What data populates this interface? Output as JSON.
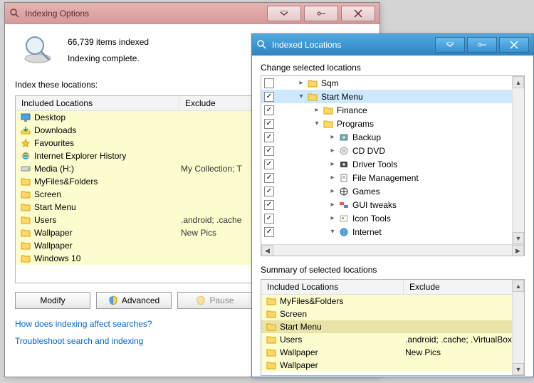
{
  "options_window": {
    "title": "Indexing Options",
    "items_indexed": "66,739 items indexed",
    "status": "Indexing complete.",
    "section_label": "Index these locations:",
    "columns": {
      "included": "Included Locations",
      "exclude": "Exclude"
    },
    "rows": [
      {
        "icon": "desktop",
        "name": "Desktop",
        "exclude": ""
      },
      {
        "icon": "downloads",
        "name": "Downloads",
        "exclude": ""
      },
      {
        "icon": "star",
        "name": "Favourites",
        "exclude": ""
      },
      {
        "icon": "ie",
        "name": "Internet Explorer History",
        "exclude": ""
      },
      {
        "icon": "drive",
        "name": "Media (H:)",
        "exclude": "My Collection; T"
      },
      {
        "icon": "folder",
        "name": "MyFiles&Folders",
        "exclude": ""
      },
      {
        "icon": "folder",
        "name": "Screen",
        "exclude": ""
      },
      {
        "icon": "folder",
        "name": "Start Menu",
        "exclude": ""
      },
      {
        "icon": "folder",
        "name": "Users",
        "exclude": ".android; .cache"
      },
      {
        "icon": "folder",
        "name": "Wallpaper",
        "exclude": "New Pics"
      },
      {
        "icon": "folder",
        "name": "Wallpaper",
        "exclude": ""
      },
      {
        "icon": "folder",
        "name": "Windows 10",
        "exclude": ""
      }
    ],
    "buttons": {
      "modify": "Modify",
      "advanced": "Advanced",
      "pause": "Pause"
    },
    "link1": "How does indexing affect searches?",
    "link2": "Troubleshoot search and indexing"
  },
  "locations_window": {
    "title": "Indexed Locations",
    "change_label": "Change selected locations",
    "tree": [
      {
        "checked": false,
        "depth": 0,
        "expander": ">",
        "icon": "folder",
        "name": "Sqm"
      },
      {
        "checked": true,
        "depth": 0,
        "expander": "v",
        "icon": "folder",
        "name": "Start Menu",
        "selected": true
      },
      {
        "checked": true,
        "depth": 1,
        "expander": ">",
        "icon": "folder",
        "name": "Finance"
      },
      {
        "checked": true,
        "depth": 1,
        "expander": "v",
        "icon": "folder",
        "name": "Programs"
      },
      {
        "checked": true,
        "depth": 2,
        "expander": ">",
        "icon": "backup",
        "name": "Backup"
      },
      {
        "checked": true,
        "depth": 2,
        "expander": ">",
        "icon": "cd",
        "name": "CD DVD"
      },
      {
        "checked": true,
        "depth": 2,
        "expander": ">",
        "icon": "driver",
        "name": "Driver Tools"
      },
      {
        "checked": true,
        "depth": 2,
        "expander": ">",
        "icon": "file",
        "name": "File Management"
      },
      {
        "checked": true,
        "depth": 2,
        "expander": ">",
        "icon": "ball",
        "name": "Games"
      },
      {
        "checked": true,
        "depth": 2,
        "expander": ">",
        "icon": "gui",
        "name": "GUI tweaks"
      },
      {
        "checked": true,
        "depth": 2,
        "expander": ">",
        "icon": "icon",
        "name": "Icon Tools"
      },
      {
        "checked": true,
        "depth": 2,
        "expander": "v",
        "icon": "net",
        "name": "Internet"
      }
    ],
    "summary_label": "Summary of selected locations",
    "summary_columns": {
      "included": "Included Locations",
      "exclude": "Exclude"
    },
    "summary": [
      {
        "icon": "folder",
        "name": "MyFiles&Folders",
        "exclude": ""
      },
      {
        "icon": "folder",
        "name": "Screen",
        "exclude": ""
      },
      {
        "icon": "folder",
        "name": "Start Menu",
        "exclude": "",
        "selected": true
      },
      {
        "icon": "folder",
        "name": "Users",
        "exclude": ".android; .cache; .VirtualBox;"
      },
      {
        "icon": "folder",
        "name": "Wallpaper",
        "exclude": "New Pics"
      },
      {
        "icon": "folder",
        "name": "Wallpaper",
        "exclude": ""
      }
    ]
  }
}
